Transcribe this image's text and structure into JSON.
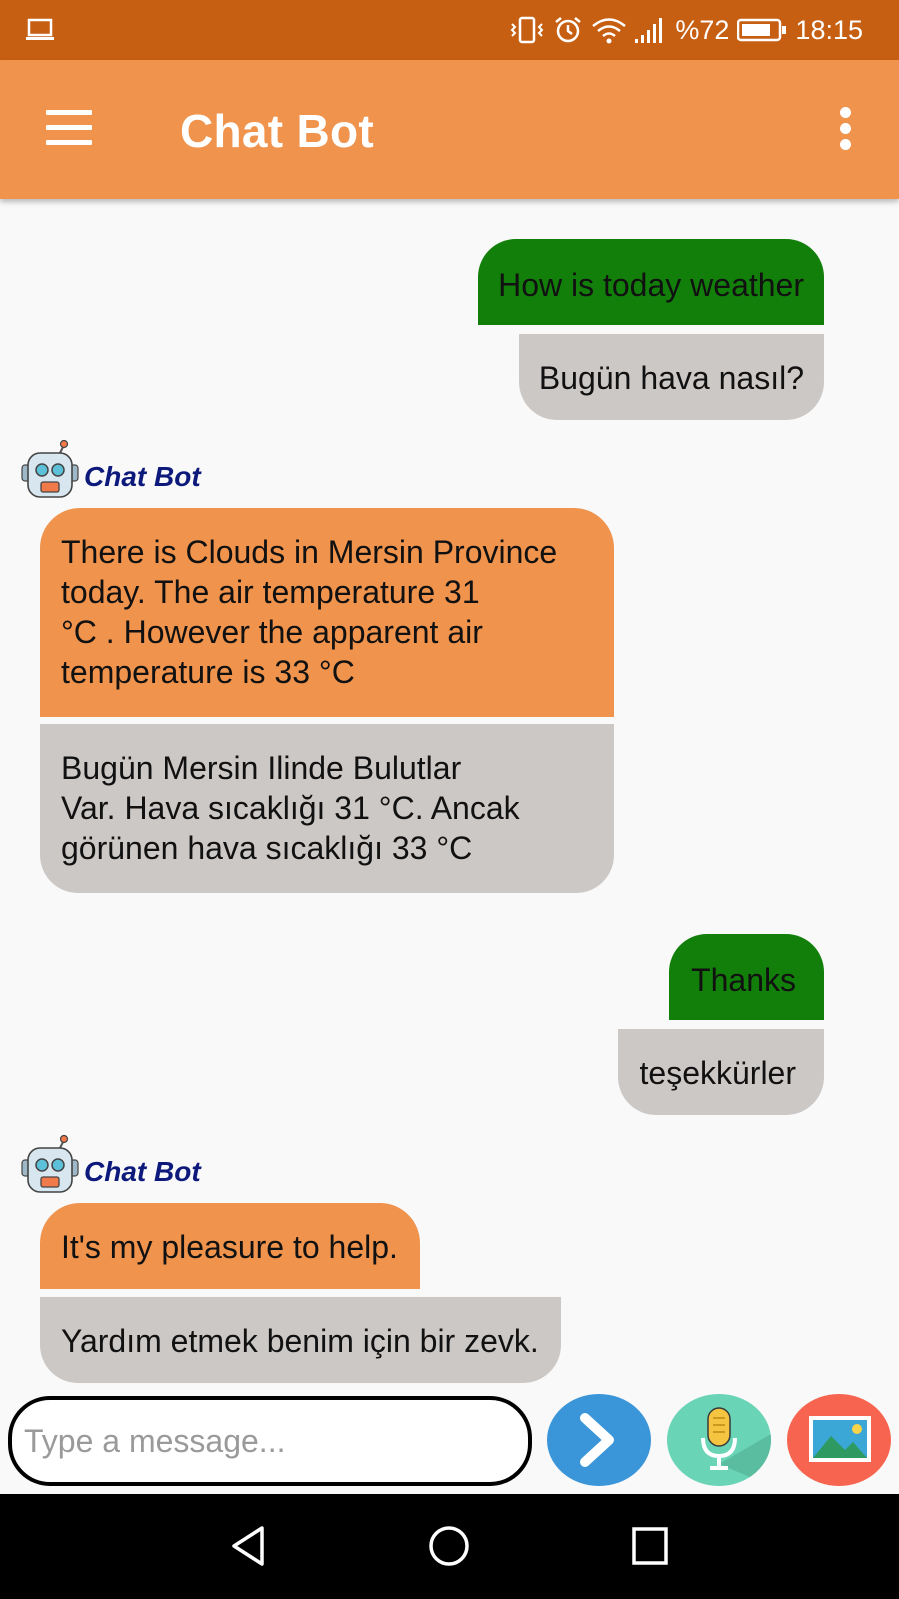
{
  "status_bar": {
    "battery_text": "%72",
    "time": "18:15"
  },
  "app_bar": {
    "title": "Chat Bot"
  },
  "messages": [
    {
      "sender": "user",
      "text": "How is today weather",
      "translation": "Bugün hava nasıl?"
    },
    {
      "sender": "bot",
      "name": "Chat Bot",
      "lines": [
        "There is Clouds in Mersin Province",
        "today. The air temperature 31",
        "°C . However the apparent air",
        "temperature is 33 °C"
      ],
      "translation_lines": [
        "Bugün Mersin Ilinde Bulutlar",
        "Var. Hava sıcaklığı 31 °C. Ancak",
        "görünen hava sıcaklığı 33 °C"
      ]
    },
    {
      "sender": "user",
      "text": "Thanks",
      "translation": "teşekkürler"
    },
    {
      "sender": "bot",
      "name": "Chat Bot",
      "text": "It's my pleasure to help.",
      "translation": "Yardım etmek benim için bir zevk."
    }
  ],
  "input": {
    "placeholder": "Type a message..."
  },
  "icons": {
    "menu": "hamburger-menu-icon",
    "more": "more-vert-icon",
    "send": "send-arrow-icon",
    "mic": "microphone-icon",
    "image": "image-gallery-icon"
  },
  "colors": {
    "status_bar": "#c65f12",
    "app_bar": "#ef934d",
    "user_bubble": "#127f0b",
    "bot_bubble": "#ef934d",
    "translation_bubble": "#ccc8c6",
    "bot_name": "#0d1a7c",
    "send_button": "#3a95d9",
    "mic_button": "#6ad4b6",
    "image_button": "#f76450"
  }
}
